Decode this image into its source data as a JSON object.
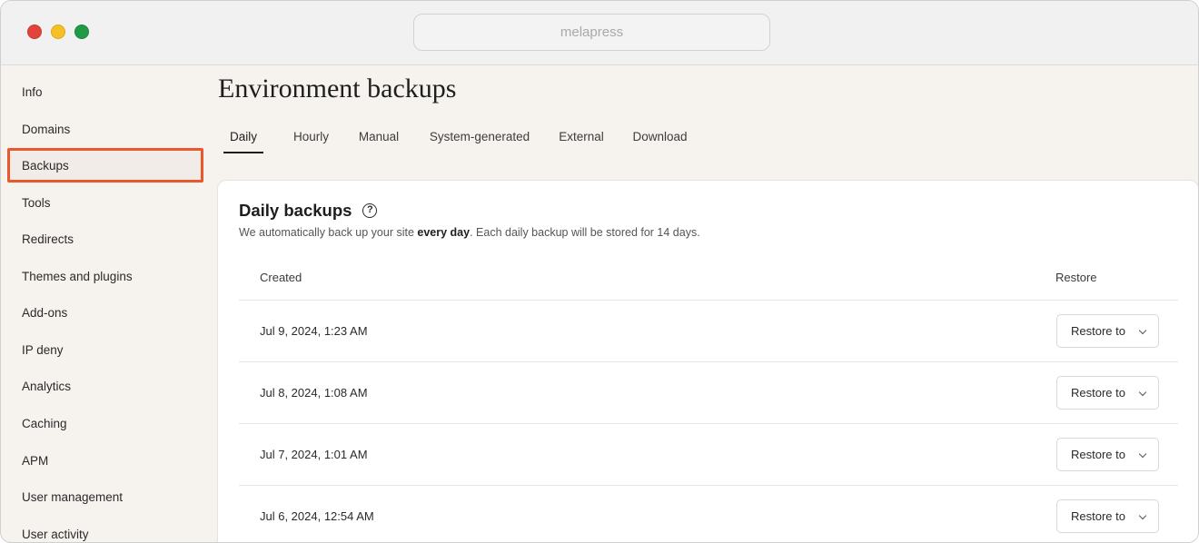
{
  "browser": {
    "address": "melapress"
  },
  "sidebar": {
    "items": [
      {
        "label": "Info"
      },
      {
        "label": "Domains"
      },
      {
        "label": "Backups"
      },
      {
        "label": "Tools"
      },
      {
        "label": "Redirects"
      },
      {
        "label": "Themes and plugins"
      },
      {
        "label": "Add-ons"
      },
      {
        "label": "IP deny"
      },
      {
        "label": "Analytics"
      },
      {
        "label": "Caching"
      },
      {
        "label": "APM"
      },
      {
        "label": "User management"
      },
      {
        "label": "User activity"
      }
    ],
    "active": "Backups"
  },
  "page": {
    "title": "Environment backups"
  },
  "tabs": [
    {
      "label": "Daily"
    },
    {
      "label": "Hourly"
    },
    {
      "label": "Manual"
    },
    {
      "label": "System-generated"
    },
    {
      "label": "External"
    },
    {
      "label": "Download"
    }
  ],
  "card": {
    "title": "Daily backups",
    "help_icon": "help-circle-icon",
    "desc_before": "We automatically back up your site ",
    "desc_bold": "every day",
    "desc_after": ". Each daily backup will be stored for 14 days."
  },
  "table": {
    "columns": {
      "created": "Created",
      "restore": "Restore"
    },
    "rows": [
      {
        "created": "Jul 9, 2024, 1:23 AM",
        "action": "Restore to"
      },
      {
        "created": "Jul 8, 2024, 1:08 AM",
        "action": "Restore to"
      },
      {
        "created": "Jul 7, 2024, 1:01 AM",
        "action": "Restore to"
      },
      {
        "created": "Jul 6, 2024, 12:54 AM",
        "action": "Restore to"
      }
    ]
  },
  "colors": {
    "accent": "#e9572c",
    "page_bg": "#f6f3ef"
  }
}
